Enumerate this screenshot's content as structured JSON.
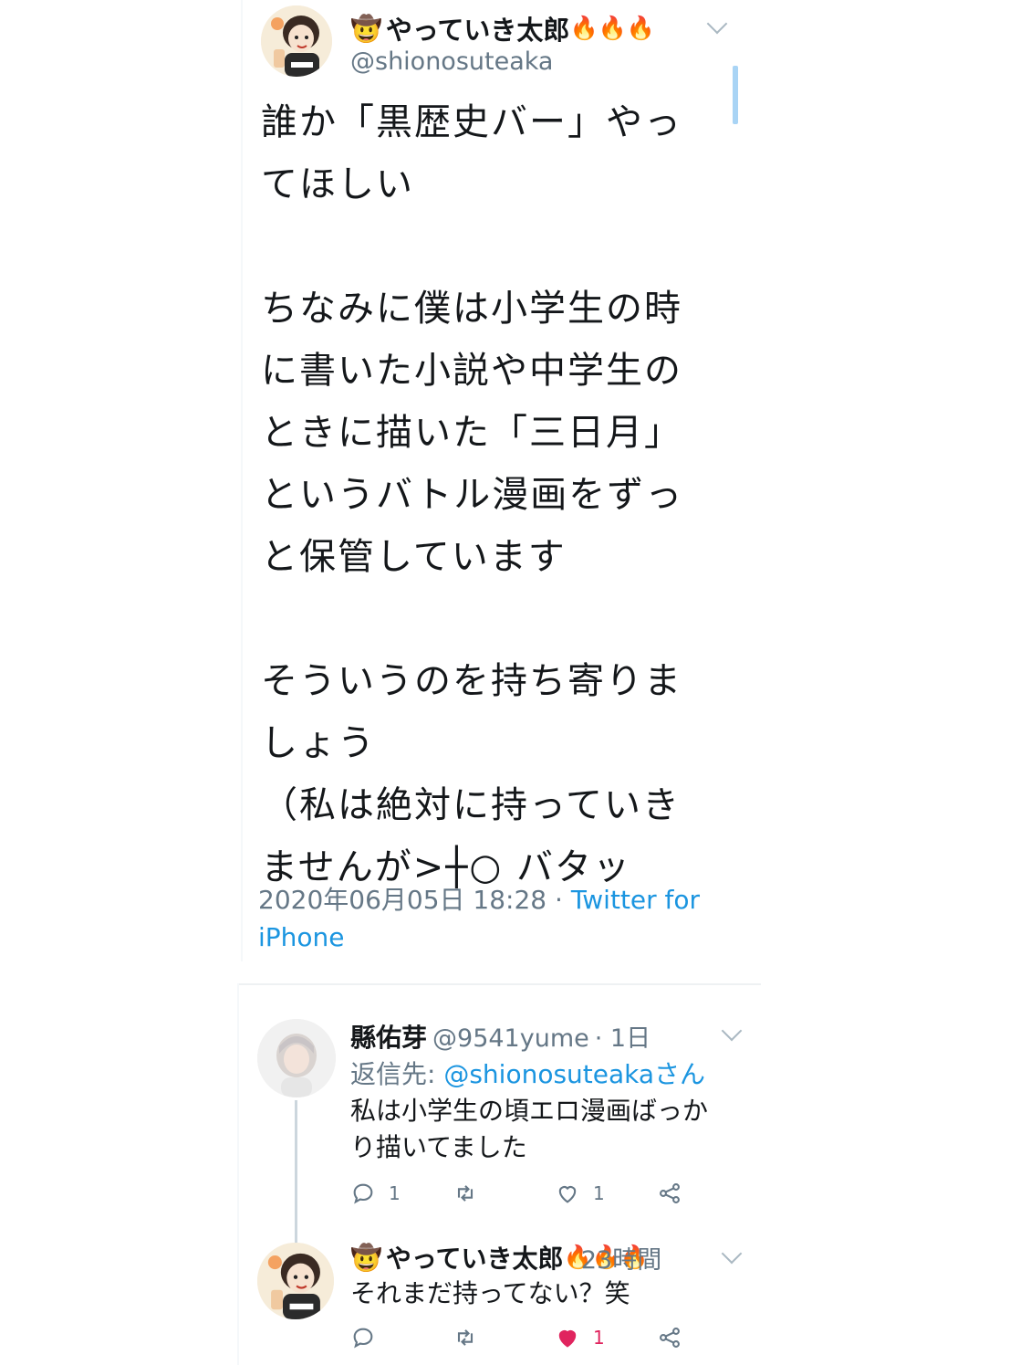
{
  "main_tweet": {
    "display_name": "やっていき太郎",
    "name_emoji_prefix": "🤠",
    "name_emoji_suffix": "🔥🔥🔥",
    "handle": "@shionosuteaka",
    "paragraphs": [
      [
        "誰か「黒歴史バー」やっ",
        "てほしい"
      ],
      [
        "ちなみに僕は小学生の時",
        "に書いた小説や中学生の",
        "ときに描いた「三日月」",
        "というバトル漫画をずっ",
        "と保管しています"
      ],
      [
        "そういうのを持ち寄りま",
        "しょう",
        "（私は絶対に持っていき",
        "ませんが>┼○ バタッ"
      ]
    ],
    "timestamp": "2020年06月05日 18:28",
    "separator": " · ",
    "source_line1": "Twitter for",
    "source_line2": "iPhone"
  },
  "reply_1": {
    "display_name": "縣佑芽",
    "handle": "@9541yume",
    "time": "· 1日",
    "reply_to_prefix": "返信先: ",
    "reply_to_handle": "@shionosuteaka",
    "reply_to_suffix": "さん",
    "text_lines": [
      "私は小学生の頃エロ漫画ばっか",
      "り描いてました"
    ],
    "reply_count": "1",
    "like_count": "1"
  },
  "reply_2": {
    "display_name": "やっていき太郎",
    "name_emoji_prefix": "🤠",
    "name_emoji_suffix": "🔥🔥🔥",
    "time": "23時間",
    "text": "それまだ持ってない？笑",
    "like_count": "1",
    "liked": true
  },
  "colors": {
    "text": "#14171a",
    "secondary": "#657786",
    "link": "#1b95e0",
    "like_active": "#e0245e",
    "icon": "#657786"
  },
  "icons": {
    "reply": "reply-icon",
    "retweet": "retweet-icon",
    "like": "heart-icon",
    "share": "share-icon",
    "menu": "chevron-down-icon"
  }
}
